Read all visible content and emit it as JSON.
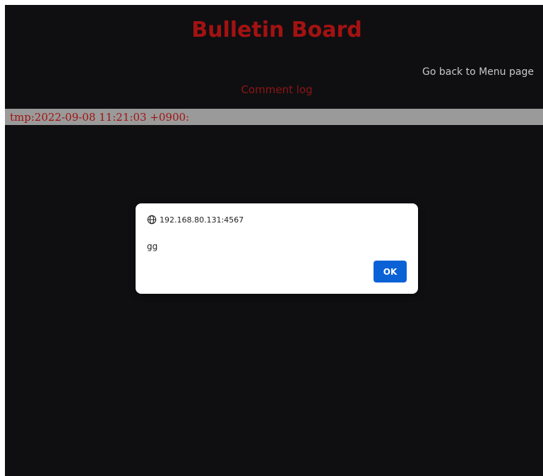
{
  "page": {
    "title": "Bulletin Board",
    "menu_link": "Go back to Menu page",
    "log_heading": "Comment log"
  },
  "comments": [
    {
      "text": "tmp:2022-09-08 11:21:03 +0900:"
    }
  ],
  "dialog": {
    "origin": "192.168.80.131:4567",
    "message": "gg",
    "ok_label": "OK",
    "icon": "globe-icon"
  },
  "colors": {
    "page_background": "#0f0f11",
    "title": "#a31212",
    "log_row_background": "#9a9a9a",
    "button": "#0b62d6"
  }
}
